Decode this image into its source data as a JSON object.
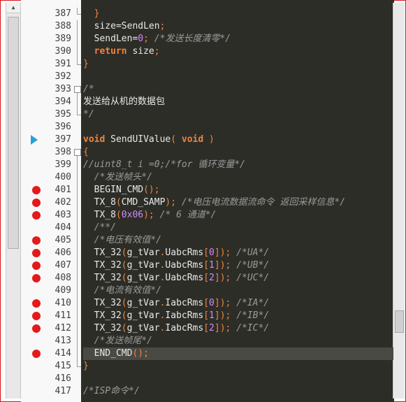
{
  "editor": {
    "lines": [
      {
        "n": "387",
        "fold": "elbow",
        "bp": false,
        "arrow": false,
        "hl": false,
        "tokens": [
          {
            "t": "  "
          },
          {
            "t": "}",
            "c": "punct"
          }
        ]
      },
      {
        "n": "388",
        "fold": "line",
        "bp": false,
        "arrow": false,
        "hl": false,
        "tokens": [
          {
            "t": "  size=SendLen"
          },
          {
            "t": ";",
            "c": "punct"
          }
        ]
      },
      {
        "n": "389",
        "fold": "line",
        "bp": false,
        "arrow": false,
        "hl": false,
        "tokens": [
          {
            "t": "  SendLen="
          },
          {
            "t": "0",
            "c": "num"
          },
          {
            "t": "; ",
            "c": "punct"
          },
          {
            "t": "/*发送长度清零*/",
            "c": "com"
          }
        ]
      },
      {
        "n": "390",
        "fold": "line",
        "bp": false,
        "arrow": false,
        "hl": false,
        "tokens": [
          {
            "t": "  "
          },
          {
            "t": "return",
            "c": "kw"
          },
          {
            "t": " size"
          },
          {
            "t": ";",
            "c": "punct"
          }
        ]
      },
      {
        "n": "391",
        "fold": "elbow",
        "bp": false,
        "arrow": false,
        "hl": false,
        "tokens": [
          {
            "t": "}",
            "c": "punct"
          }
        ]
      },
      {
        "n": "392",
        "fold": "",
        "bp": false,
        "arrow": false,
        "hl": false,
        "tokens": []
      },
      {
        "n": "393",
        "fold": "box",
        "bp": false,
        "arrow": false,
        "hl": false,
        "tokens": [
          {
            "t": "/*",
            "c": "com"
          }
        ]
      },
      {
        "n": "394",
        "fold": "line",
        "bp": false,
        "arrow": false,
        "hl": false,
        "tokens": [
          {
            "t": "发送给从机的数据包",
            "c": "cm"
          }
        ]
      },
      {
        "n": "395",
        "fold": "elbow",
        "bp": false,
        "arrow": false,
        "hl": false,
        "tokens": [
          {
            "t": "*/",
            "c": "com"
          }
        ]
      },
      {
        "n": "396",
        "fold": "",
        "bp": false,
        "arrow": false,
        "hl": false,
        "tokens": []
      },
      {
        "n": "397",
        "fold": "",
        "bp": false,
        "arrow": true,
        "hl": false,
        "tokens": [
          {
            "t": "void",
            "c": "kw"
          },
          {
            "t": " SendUIValue"
          },
          {
            "t": "( ",
            "c": "punct"
          },
          {
            "t": "void",
            "c": "kw"
          },
          {
            "t": " )",
            "c": "punct"
          }
        ]
      },
      {
        "n": "398",
        "fold": "box",
        "bp": false,
        "arrow": false,
        "hl": false,
        "tokens": [
          {
            "t": "{",
            "c": "punct"
          }
        ]
      },
      {
        "n": "399",
        "fold": "line",
        "bp": false,
        "arrow": false,
        "hl": false,
        "tokens": [
          {
            "t": "//uint8_t i =0;/*for 循环变量*/",
            "c": "com"
          }
        ]
      },
      {
        "n": "400",
        "fold": "line",
        "bp": false,
        "arrow": false,
        "hl": false,
        "tokens": [
          {
            "t": "  "
          },
          {
            "t": "/*发送帧头*/",
            "c": "com"
          }
        ]
      },
      {
        "n": "401",
        "fold": "line",
        "bp": true,
        "arrow": false,
        "hl": false,
        "tokens": [
          {
            "t": "  BEGIN_CMD"
          },
          {
            "t": "();",
            "c": "punct"
          }
        ]
      },
      {
        "n": "402",
        "fold": "line",
        "bp": true,
        "arrow": false,
        "hl": false,
        "tokens": [
          {
            "t": "  TX_8"
          },
          {
            "t": "(",
            "c": "punct"
          },
          {
            "t": "CMD_SAMP"
          },
          {
            "t": "); ",
            "c": "punct"
          },
          {
            "t": "/*电压电流数据流命令 返回采样信息*/",
            "c": "com"
          }
        ]
      },
      {
        "n": "403",
        "fold": "line",
        "bp": true,
        "arrow": false,
        "hl": false,
        "tokens": [
          {
            "t": "  TX_8"
          },
          {
            "t": "(",
            "c": "punct"
          },
          {
            "t": "0x06",
            "c": "num"
          },
          {
            "t": "); ",
            "c": "punct"
          },
          {
            "t": "/* 6 通道*/",
            "c": "com"
          }
        ]
      },
      {
        "n": "404",
        "fold": "line",
        "bp": false,
        "arrow": false,
        "hl": false,
        "tokens": [
          {
            "t": "  "
          },
          {
            "t": "/**/",
            "c": "com"
          }
        ]
      },
      {
        "n": "405",
        "fold": "line",
        "bp": true,
        "arrow": false,
        "hl": false,
        "tokens": [
          {
            "t": "  "
          },
          {
            "t": "/*电压有效值*/",
            "c": "com"
          }
        ]
      },
      {
        "n": "406",
        "fold": "line",
        "bp": true,
        "arrow": false,
        "hl": false,
        "tokens": [
          {
            "t": "  TX_32"
          },
          {
            "t": "(",
            "c": "punct"
          },
          {
            "t": "g_tVar"
          },
          {
            "t": ".",
            "c": "punct"
          },
          {
            "t": "UabcRms"
          },
          {
            "t": "[",
            "c": "punct"
          },
          {
            "t": "0",
            "c": "num"
          },
          {
            "t": "]); ",
            "c": "punct"
          },
          {
            "t": "/*UA*/",
            "c": "com"
          }
        ]
      },
      {
        "n": "407",
        "fold": "line",
        "bp": true,
        "arrow": false,
        "hl": false,
        "tokens": [
          {
            "t": "  TX_32"
          },
          {
            "t": "(",
            "c": "punct"
          },
          {
            "t": "g_tVar"
          },
          {
            "t": ".",
            "c": "punct"
          },
          {
            "t": "UabcRms"
          },
          {
            "t": "[",
            "c": "punct"
          },
          {
            "t": "1",
            "c": "num"
          },
          {
            "t": "]); ",
            "c": "punct"
          },
          {
            "t": "/*UB*/",
            "c": "com"
          }
        ]
      },
      {
        "n": "408",
        "fold": "line",
        "bp": true,
        "arrow": false,
        "hl": false,
        "tokens": [
          {
            "t": "  TX_32"
          },
          {
            "t": "(",
            "c": "punct"
          },
          {
            "t": "g_tVar"
          },
          {
            "t": ".",
            "c": "punct"
          },
          {
            "t": "UabcRms"
          },
          {
            "t": "[",
            "c": "punct"
          },
          {
            "t": "2",
            "c": "num"
          },
          {
            "t": "]); ",
            "c": "punct"
          },
          {
            "t": "/*UC*/",
            "c": "com"
          }
        ]
      },
      {
        "n": "409",
        "fold": "line",
        "bp": false,
        "arrow": false,
        "hl": false,
        "tokens": [
          {
            "t": "  "
          },
          {
            "t": "/*电流有效值*/",
            "c": "com"
          }
        ]
      },
      {
        "n": "410",
        "fold": "line",
        "bp": true,
        "arrow": false,
        "hl": false,
        "tokens": [
          {
            "t": "  TX_32"
          },
          {
            "t": "(",
            "c": "punct"
          },
          {
            "t": "g_tVar"
          },
          {
            "t": ".",
            "c": "punct"
          },
          {
            "t": "IabcRms"
          },
          {
            "t": "[",
            "c": "punct"
          },
          {
            "t": "0",
            "c": "num"
          },
          {
            "t": "]); ",
            "c": "punct"
          },
          {
            "t": "/*IA*/",
            "c": "com"
          }
        ]
      },
      {
        "n": "411",
        "fold": "line",
        "bp": true,
        "arrow": false,
        "hl": false,
        "tokens": [
          {
            "t": "  TX_32"
          },
          {
            "t": "(",
            "c": "punct"
          },
          {
            "t": "g_tVar"
          },
          {
            "t": ".",
            "c": "punct"
          },
          {
            "t": "IabcRms"
          },
          {
            "t": "[",
            "c": "punct"
          },
          {
            "t": "1",
            "c": "num"
          },
          {
            "t": "]); ",
            "c": "punct"
          },
          {
            "t": "/*IB*/",
            "c": "com"
          }
        ]
      },
      {
        "n": "412",
        "fold": "line",
        "bp": true,
        "arrow": false,
        "hl": false,
        "tokens": [
          {
            "t": "  TX_32"
          },
          {
            "t": "(",
            "c": "punct"
          },
          {
            "t": "g_tVar"
          },
          {
            "t": ".",
            "c": "punct"
          },
          {
            "t": "IabcRms"
          },
          {
            "t": "[",
            "c": "punct"
          },
          {
            "t": "2",
            "c": "num"
          },
          {
            "t": "]); ",
            "c": "punct"
          },
          {
            "t": "/*IC*/",
            "c": "com"
          }
        ]
      },
      {
        "n": "413",
        "fold": "line",
        "bp": false,
        "arrow": false,
        "hl": false,
        "tokens": [
          {
            "t": "  "
          },
          {
            "t": "/*发送帧尾*/",
            "c": "com"
          }
        ]
      },
      {
        "n": "414",
        "fold": "line",
        "bp": true,
        "arrow": false,
        "hl": true,
        "tokens": [
          {
            "t": "  END_CMD"
          },
          {
            "t": "();",
            "c": "punct"
          }
        ]
      },
      {
        "n": "415",
        "fold": "elbow",
        "bp": false,
        "arrow": false,
        "hl": false,
        "tokens": [
          {
            "t": "}",
            "c": "punct"
          }
        ]
      },
      {
        "n": "416",
        "fold": "",
        "bp": false,
        "arrow": false,
        "hl": false,
        "tokens": []
      },
      {
        "n": "417",
        "fold": "",
        "bp": false,
        "arrow": false,
        "hl": false,
        "tokens": [
          {
            "t": "/*ISP命令*/",
            "c": "com"
          }
        ]
      }
    ]
  },
  "colors": {
    "editor_bg": "#2d2d28",
    "keyword": "#f0843a",
    "number": "#d08aff",
    "comment": "#9a9a9a",
    "breakpoint": "#e41a1a",
    "arrow": "#2a9fd8",
    "frame": "#e01010"
  },
  "icons": {
    "breakpoint": "breakpoint-icon",
    "current_line": "execution-arrow-icon",
    "fold": "fold-toggle-icon"
  }
}
